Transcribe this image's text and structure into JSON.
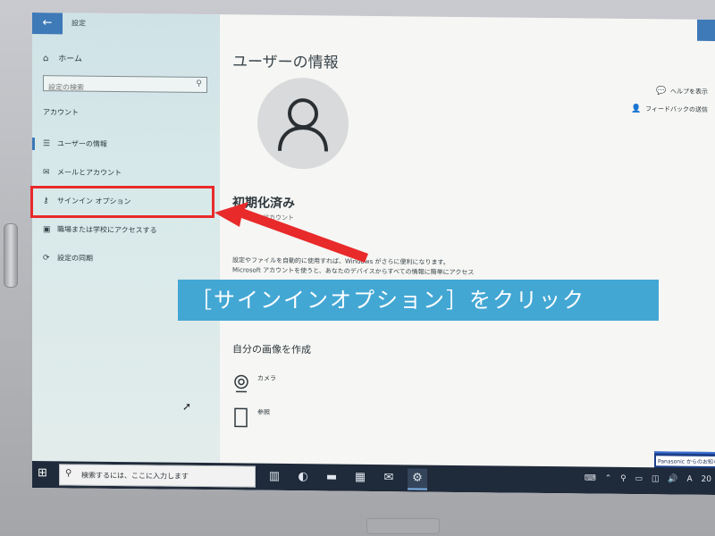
{
  "window": {
    "app_title": "設定",
    "back_icon": "back-arrow-icon"
  },
  "nav": {
    "home": "ホーム",
    "search_placeholder": "設定の検索",
    "section_heading": "アカウント",
    "items": [
      {
        "label": "ユーザーの情報",
        "icon": "user-info-icon"
      },
      {
        "label": "メールとアカウント",
        "icon": "mail-icon"
      },
      {
        "label": "サインイン オプション",
        "icon": "key-icon"
      },
      {
        "label": "職場または学校にアクセスする",
        "icon": "briefcase-icon"
      },
      {
        "label": "設定の同期",
        "icon": "sync-icon"
      }
    ]
  },
  "main": {
    "page_title": "ユーザーの情報",
    "user_name": "初期化済み",
    "account_type": "アカウント",
    "description_line1": "設定やファイルを自動的に使用すれば、Windows がさらに便利になります。",
    "description_line2": "Microsoft アカウントを使うと、あなたのデバイスからすべての情報に簡単にアクセス",
    "create_picture_heading": "自分の画像を作成",
    "options": [
      {
        "label": "カメラ",
        "icon": "camera-icon"
      },
      {
        "label": "参照",
        "icon": "browse-file-icon"
      }
    ],
    "related": [
      {
        "label": "ヘルプを表示",
        "icon": "help-icon"
      },
      {
        "label": "フィードバックの送信",
        "icon": "feedback-icon"
      }
    ]
  },
  "notification": {
    "text": "Panasonic からのお知らせ"
  },
  "taskbar": {
    "search_placeholder": "検索するには、ここに入力します",
    "ime_label": "A",
    "clock_partial": "20"
  },
  "annotation": {
    "callout_text": "［サインインオプション］をクリック",
    "highlight_color": "#e82a2a",
    "callout_color": "#43a7d4"
  }
}
